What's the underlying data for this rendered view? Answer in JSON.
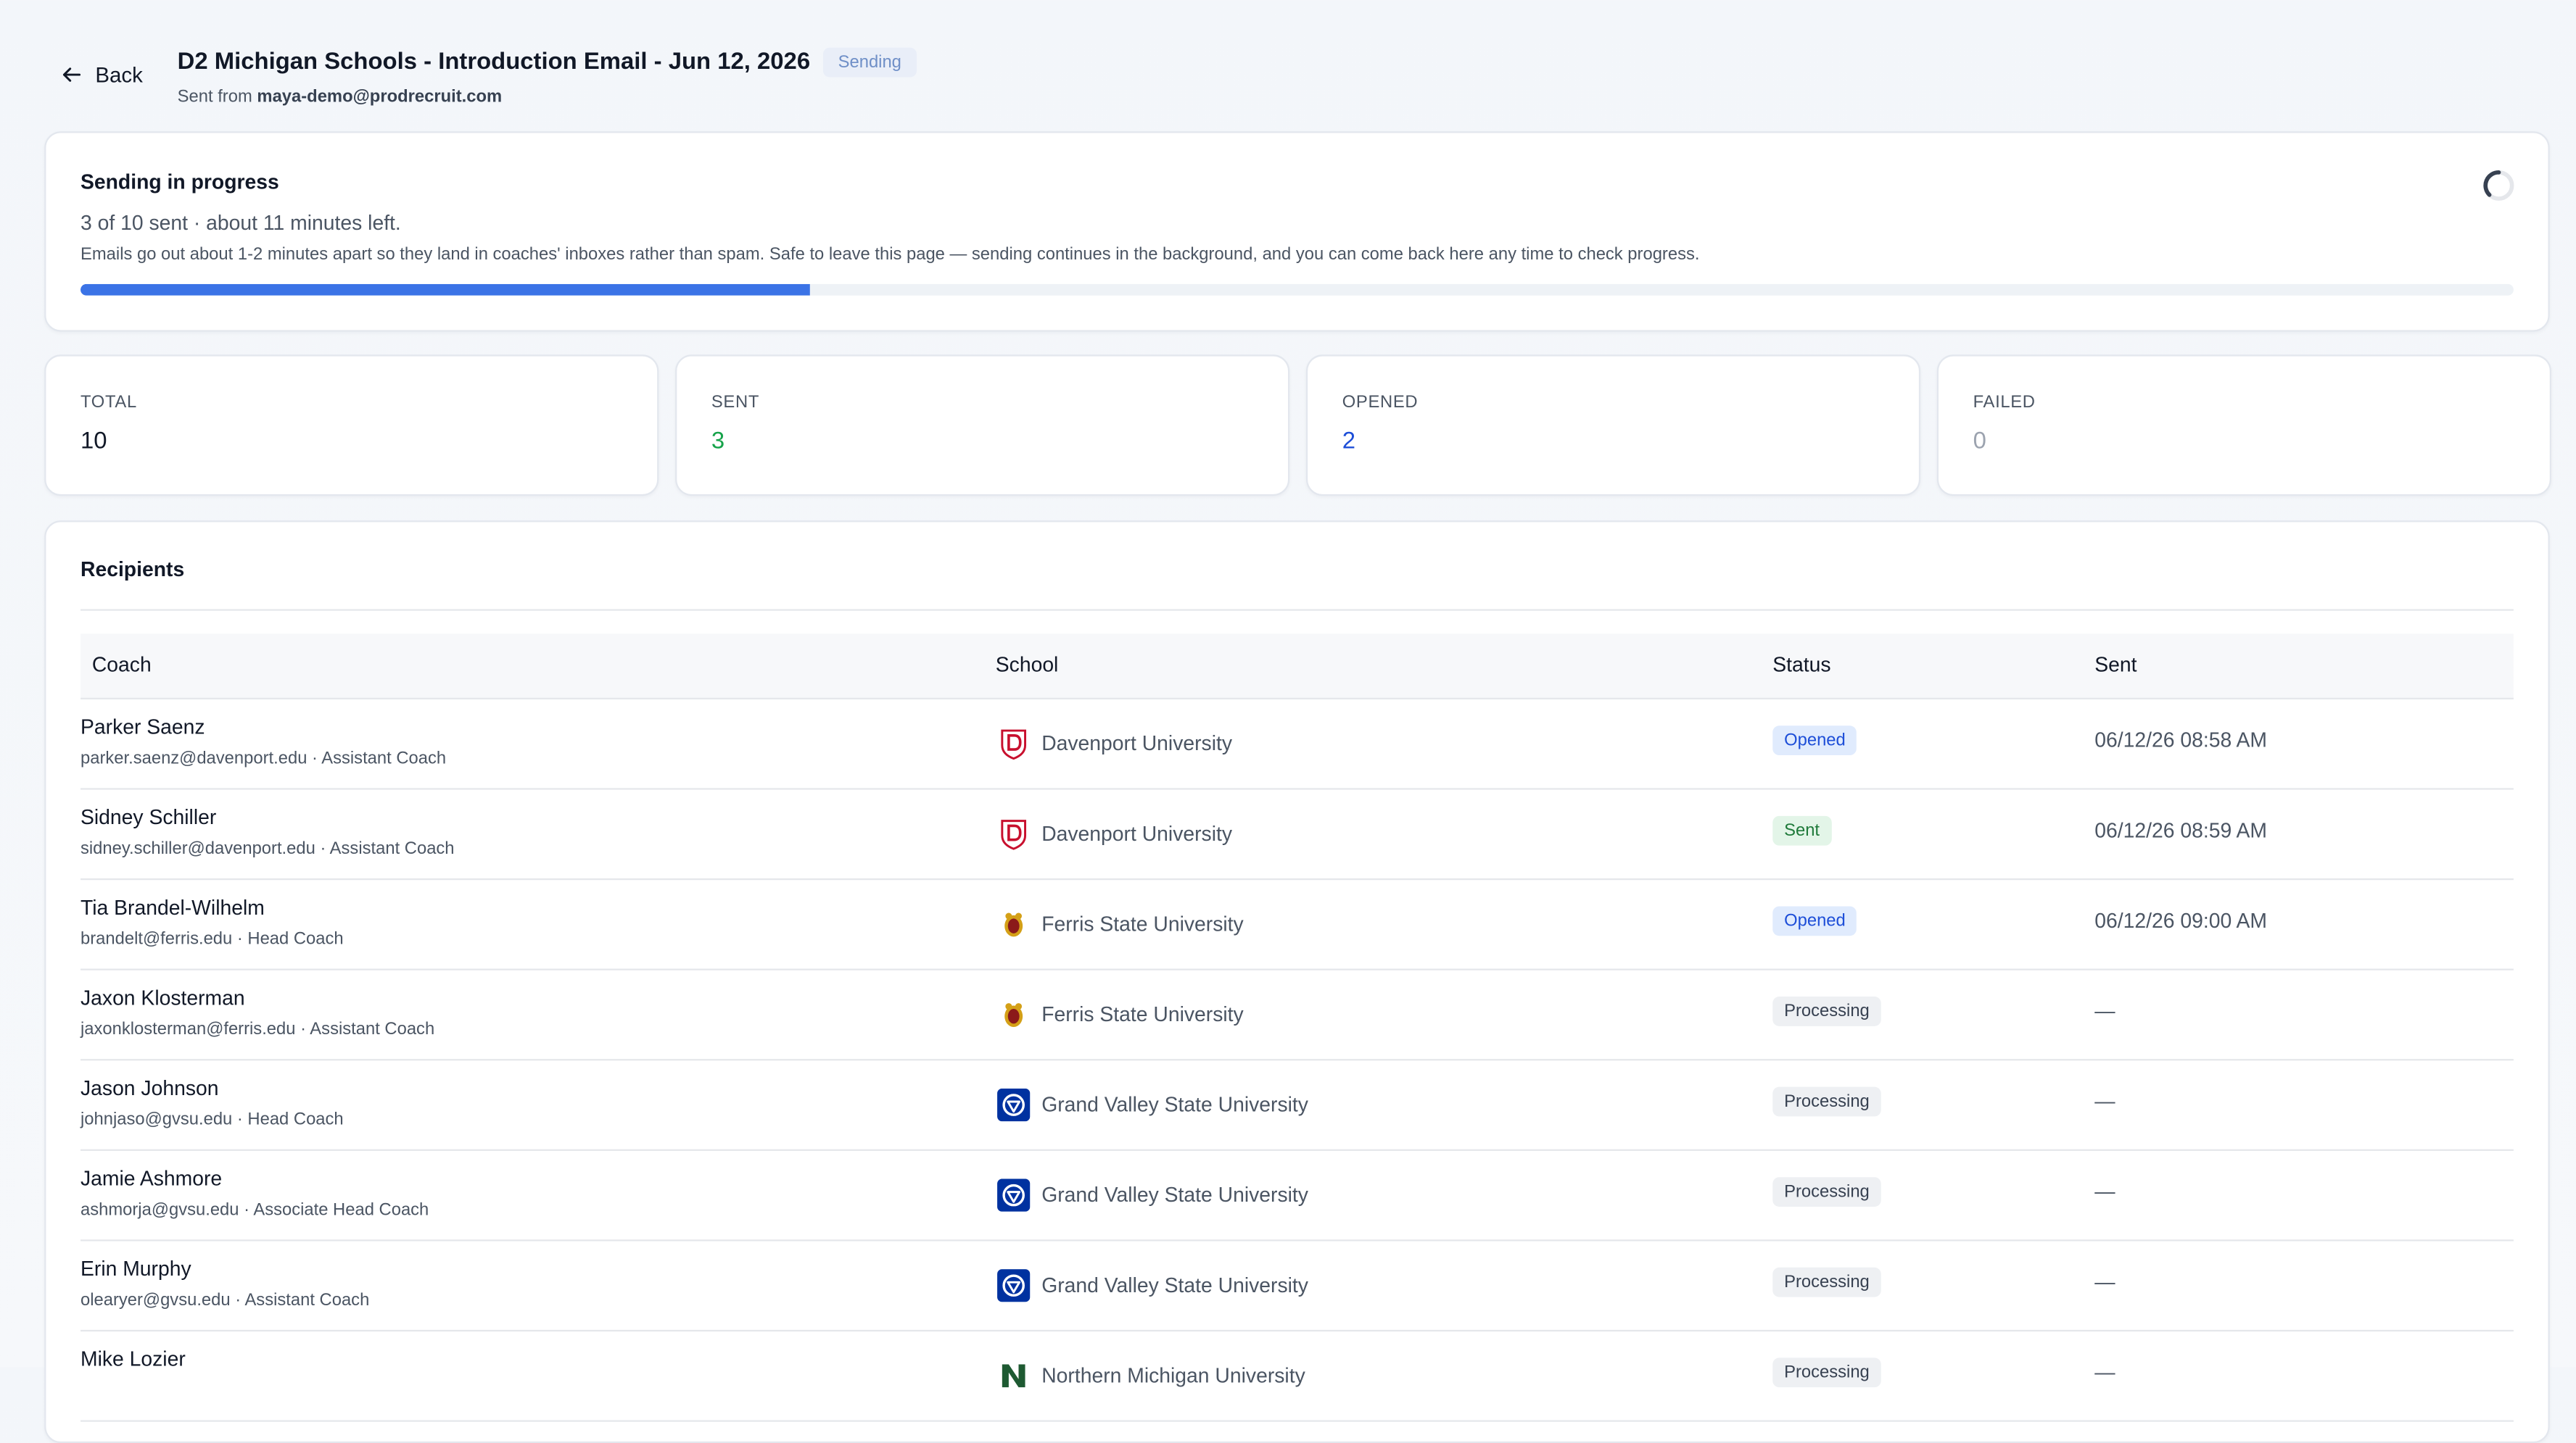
{
  "header": {
    "back_label": "Back",
    "title": "D2 Michigan Schools - Introduction Email - Jun 12, 2026",
    "status_pill": "Sending",
    "sent_from_prefix": "Sent from",
    "sent_from_email": "maya-demo@prodrecruit.com"
  },
  "progress": {
    "title": "Sending in progress",
    "count_text": "3 of 10 sent · about 11 minutes left.",
    "note": "Emails go out about 1-2 minutes apart so they land in coaches' inboxes rather than spam. Safe to leave this page — sending continues in the background, and you can come back here any time to check progress.",
    "fraction": 0.3,
    "bar_color": "#3b73e6"
  },
  "stats": [
    {
      "label": "TOTAL",
      "value": "10",
      "color": "#111827"
    },
    {
      "label": "SENT",
      "value": "3",
      "color": "#16a34a"
    },
    {
      "label": "OPENED",
      "value": "2",
      "color": "#1d4ed8"
    },
    {
      "label": "FAILED",
      "value": "0",
      "color": "#9ca3af"
    }
  ],
  "recipients": {
    "title": "Recipients",
    "columns": [
      "Coach",
      "School",
      "Status",
      "Sent"
    ],
    "rows": [
      {
        "name": "Parker Saenz",
        "sub": "parker.saenz@davenport.edu · Assistant Coach",
        "school": "Davenport University",
        "logo": "davenport-logo-icon",
        "status": "Opened",
        "status_kind": "opened",
        "sent": "06/12/26 08:58 AM"
      },
      {
        "name": "Sidney Schiller",
        "sub": "sidney.schiller@davenport.edu · Assistant Coach",
        "school": "Davenport University",
        "logo": "davenport-logo-icon",
        "status": "Sent",
        "status_kind": "sent",
        "sent": "06/12/26 08:59 AM"
      },
      {
        "name": "Tia Brandel-Wilhelm",
        "sub": "brandelt@ferris.edu · Head Coach",
        "school": "Ferris State University",
        "logo": "ferris-logo-icon",
        "status": "Opened",
        "status_kind": "opened",
        "sent": "06/12/26 09:00 AM"
      },
      {
        "name": "Jaxon Klosterman",
        "sub": "jaxonklosterman@ferris.edu · Assistant Coach",
        "school": "Ferris State University",
        "logo": "ferris-logo-icon",
        "status": "Processing",
        "status_kind": "processing",
        "sent": "—"
      },
      {
        "name": "Jason Johnson",
        "sub": "johnjaso@gvsu.edu · Head Coach",
        "school": "Grand Valley State University",
        "logo": "gvsu-logo-icon",
        "status": "Processing",
        "status_kind": "processing",
        "sent": "—"
      },
      {
        "name": "Jamie Ashmore",
        "sub": "ashmorja@gvsu.edu · Associate Head Coach",
        "school": "Grand Valley State University",
        "logo": "gvsu-logo-icon",
        "status": "Processing",
        "status_kind": "processing",
        "sent": "—"
      },
      {
        "name": "Erin Murphy",
        "sub": "olearyer@gvsu.edu · Assistant Coach",
        "school": "Grand Valley State University",
        "logo": "gvsu-logo-icon",
        "status": "Processing",
        "status_kind": "processing",
        "sent": "—"
      },
      {
        "name": "Mike Lozier",
        "sub": "",
        "school": "Northern Michigan University",
        "logo": "nmu-logo-icon",
        "status": "Processing",
        "status_kind": "processing",
        "sent": "—"
      }
    ]
  }
}
